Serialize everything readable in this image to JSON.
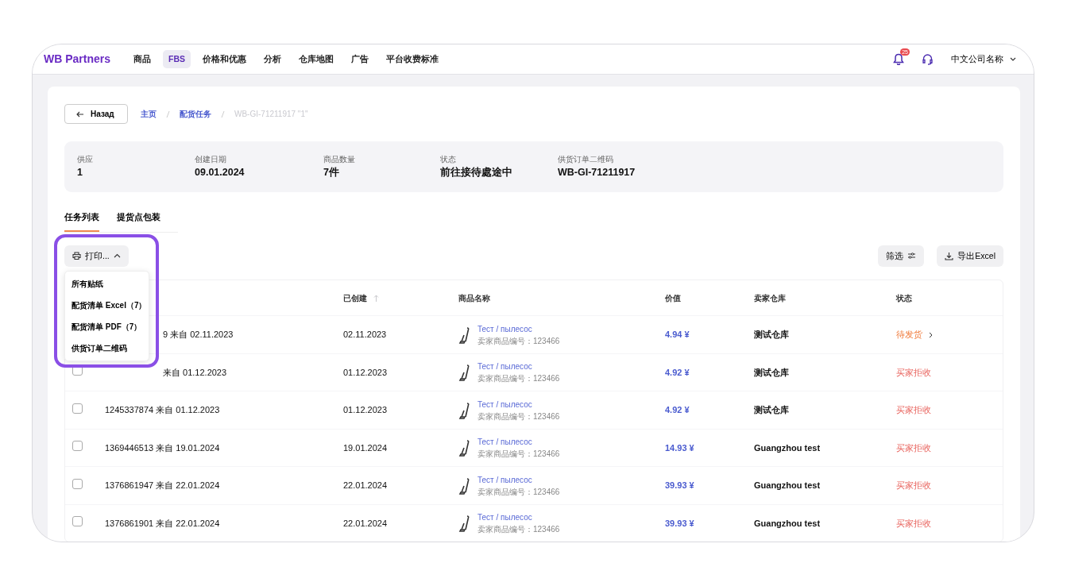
{
  "nav": {
    "logo": "WB Partners",
    "items": [
      {
        "label": "商品",
        "selected": false
      },
      {
        "label": "FBS",
        "selected": true
      },
      {
        "label": "价格和优惠",
        "selected": false
      },
      {
        "label": "分析",
        "selected": false
      },
      {
        "label": "仓库地图",
        "selected": false
      },
      {
        "label": "广告",
        "selected": false
      },
      {
        "label": "平台收费标准",
        "selected": false
      }
    ],
    "notifications": "25",
    "account": "中文公司名称"
  },
  "back_button": "Назад",
  "breadcrumbs": [
    {
      "label": "主页",
      "kind": "link"
    },
    {
      "label": "配货任务",
      "kind": "link"
    },
    {
      "label": "WB-GI-71211917 \"1\"",
      "kind": "current"
    }
  ],
  "info": [
    {
      "label": "供应",
      "value": "1"
    },
    {
      "label": "创建日期",
      "value": "09.01.2024"
    },
    {
      "label": "商品数量",
      "value": "7件"
    },
    {
      "label": "状态",
      "value": "前往接待處途中"
    },
    {
      "label": "供货订单二维码",
      "value": "WB-GI-71211917"
    }
  ],
  "tabs": [
    {
      "label": "任务列表",
      "selected": true
    },
    {
      "label": "提货点包装",
      "selected": false
    }
  ],
  "print_button": {
    "label": "打印...",
    "expanded": true
  },
  "print_menu": [
    "所有贴纸",
    "配货清单 Excel（7）",
    "配货清单 PDF（7）",
    "供货订单二维码"
  ],
  "toolbar_buttons": [
    {
      "label": "筛选",
      "kind": "filter"
    },
    {
      "label": "导出Excel",
      "kind": "export"
    }
  ],
  "table": {
    "columns": [
      {
        "label": "已创建",
        "sortable": true
      },
      {
        "label": "商品名称"
      },
      {
        "label": "价值"
      },
      {
        "label": "卖家仓库"
      },
      {
        "label": "状态"
      }
    ],
    "rows": [
      {
        "order": "9 来自 02.11.2023",
        "created": "02.11.2023",
        "product": "Тест / пылесос",
        "sku": "卖家商品编号：123466",
        "price": "4.94 ¥",
        "warehouse": "测试仓库",
        "status": "待发货",
        "kind": "pending"
      },
      {
        "checked": false,
        "order": "来自 01.12.2023",
        "created": "01.12.2023",
        "product": "Тест / пылесос",
        "sku": "卖家商品编号：123466",
        "price": "4.92 ¥",
        "warehouse": "测试仓库",
        "status": "买家拒收",
        "kind": "rejected"
      },
      {
        "checked": false,
        "order": "1245337874 来自 01.12.2023",
        "created": "01.12.2023",
        "product": "Тест / пылесос",
        "sku": "卖家商品编号：123466",
        "price": "4.92 ¥",
        "warehouse": "测试仓库",
        "status": "买家拒收",
        "kind": "rejected"
      },
      {
        "checked": false,
        "order": "1369446513 来自 19.01.2024",
        "created": "19.01.2024",
        "product": "Тест / пылесос",
        "sku": "卖家商品编号：123466",
        "price": "14.93 ¥",
        "warehouse": "Guangzhou test",
        "status": "买家拒收",
        "kind": "rejected"
      },
      {
        "checked": false,
        "order": "1376861947 来自 22.01.2024",
        "created": "22.01.2024",
        "product": "Тест / пылесос",
        "sku": "卖家商品编号：123466",
        "price": "39.93 ¥",
        "warehouse": "Guangzhou test",
        "status": "买家拒收",
        "kind": "rejected"
      },
      {
        "checked": false,
        "order": "1376861901 来自 22.01.2024",
        "created": "22.01.2024",
        "product": "Тест / пылесос",
        "sku": "卖家商品编号：123466",
        "price": "39.93 ¥",
        "warehouse": "Guangzhou test",
        "status": "买家拒收",
        "kind": "rejected"
      }
    ]
  }
}
